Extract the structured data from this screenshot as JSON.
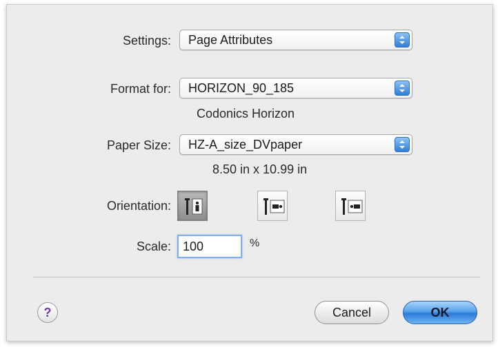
{
  "settings": {
    "label": "Settings:",
    "value": "Page Attributes"
  },
  "format_for": {
    "label": "Format for:",
    "value": "HORIZON_90_185",
    "description": "Codonics Horizon"
  },
  "paper_size": {
    "label": "Paper Size:",
    "value": "HZ-A_size_DVpaper",
    "dimensions": "8.50 in x 10.99 in"
  },
  "orientation": {
    "label": "Orientation:",
    "options": [
      "portrait",
      "landscape",
      "landscape-reverse"
    ],
    "selected": "portrait"
  },
  "scale": {
    "label": "Scale:",
    "value": "100",
    "unit": "%"
  },
  "footer": {
    "help_label": "?",
    "cancel_label": "Cancel",
    "ok_label": "OK"
  },
  "colors": {
    "accent": "#3a86e0",
    "dialog_bg": "#ececec",
    "help": "#6a3aa8"
  }
}
